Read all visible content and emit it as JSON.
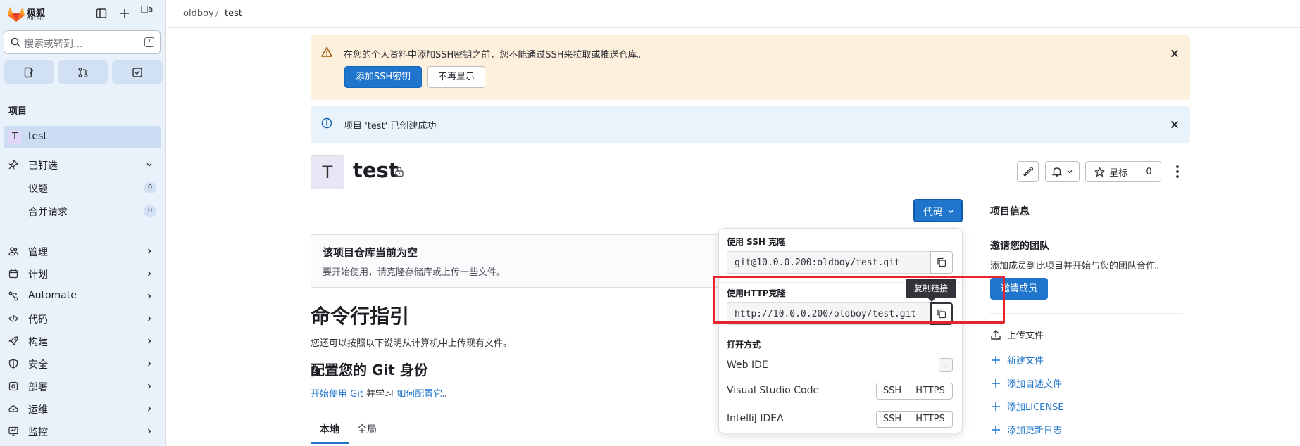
{
  "brand": {
    "name": "极狐",
    "sub": "GitLab"
  },
  "avatar_alt": "a",
  "search": {
    "placeholder": "搜索或转到...",
    "shortcut": "/"
  },
  "sidebar": {
    "section": "项目",
    "project": {
      "initial": "T",
      "name": "test"
    },
    "pinned": {
      "label": "已钉选",
      "items": [
        {
          "label": "议题",
          "count": "0"
        },
        {
          "label": "合并请求",
          "count": "0"
        }
      ]
    },
    "items": [
      {
        "label": "管理",
        "icon": "users-icon"
      },
      {
        "label": "计划",
        "icon": "planning-icon"
      },
      {
        "label": "Automate",
        "icon": "automate-icon"
      },
      {
        "label": "代码",
        "icon": "code-icon"
      },
      {
        "label": "构建",
        "icon": "rocket-icon"
      },
      {
        "label": "安全",
        "icon": "shield-icon"
      },
      {
        "label": "部署",
        "icon": "deploy-icon"
      },
      {
        "label": "运维",
        "icon": "cloud-gear-icon"
      },
      {
        "label": "监控",
        "icon": "monitor-icon"
      }
    ]
  },
  "breadcrumb": {
    "group": "oldboy",
    "sep": "/",
    "project": "test"
  },
  "alerts": {
    "ssh": {
      "text": "在您的个人资料中添加SSH密钥之前，您不能通过SSH来拉取或推送仓库。",
      "add_btn": "添加SSH密钥",
      "dismiss_btn": "不再显示"
    },
    "created": {
      "text": "项目 'test' 已创建成功。"
    }
  },
  "project": {
    "initial": "T",
    "title": "test",
    "star_label": "星标",
    "star_count": "0"
  },
  "code_button": {
    "label": "代码"
  },
  "clone_dropdown": {
    "ssh_heading": "使用 SSH 克隆",
    "ssh_url": "git@10.0.0.200:oldboy/test.git",
    "http_heading": "使用HTTP克隆",
    "http_url": "http://10.0.0.200/oldboy/test.git",
    "open_with_heading": "打开方式",
    "web_ide": {
      "label": "Web IDE",
      "key": "."
    },
    "vscode": {
      "label": "Visual Studio Code",
      "ssh": "SSH",
      "https": "HTTPS"
    },
    "intellij": {
      "label": "IntelliJ IDEA",
      "ssh": "SSH",
      "https": "HTTPS"
    }
  },
  "tooltip": "复制链接",
  "empty_repo": {
    "title": "该项目仓库当前为空",
    "subtitle": "要开始使用，请克隆存储库或上传一些文件。"
  },
  "cli": {
    "heading": "命令行指引",
    "intro": "您还可以按照以下说明从计算机中上传现有文件。",
    "git_identity_heading": "配置您的 Git 身份",
    "link_start": "开始使用 Git",
    "link_mid": " 并学习 ",
    "link_config": "如何配置它",
    "link_end": "。",
    "tabs": [
      "本地",
      "全局"
    ]
  },
  "right_panel": {
    "title": "项目信息",
    "invite_title": "邀请您的团队",
    "invite_sub": "添加成员到此项目并开始与您的团队合作。",
    "invite_btn": "邀请成员",
    "links": [
      {
        "label": "上传文件",
        "icon": "upload-icon"
      },
      {
        "label": "新建文件",
        "icon": "plus-icon"
      },
      {
        "label": "添加自述文件",
        "icon": "plus-icon"
      },
      {
        "label": "添加LICENSE",
        "icon": "plus-icon"
      },
      {
        "label": "添加更新日志",
        "icon": "plus-icon"
      }
    ]
  },
  "colors": {
    "primary": "#1f75cb",
    "warn_bg": "#fdf1dd",
    "info_bg": "#e9f3fc",
    "sidebar_bg": "#e9f1fb",
    "highlight": "#e4262c"
  }
}
